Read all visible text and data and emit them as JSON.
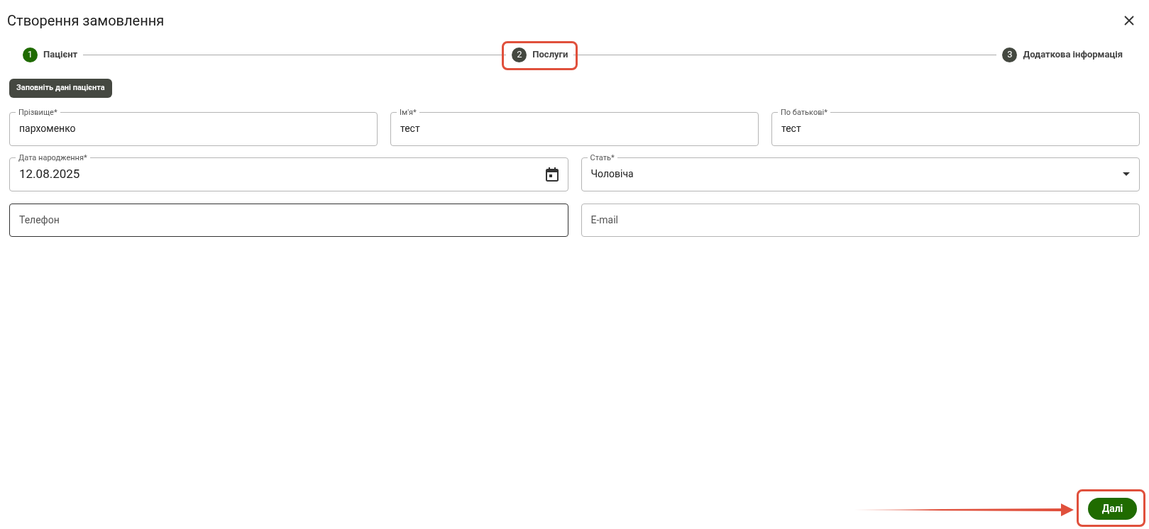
{
  "dialog": {
    "title": "Створення замовлення"
  },
  "steps": [
    {
      "number": "1",
      "label": "Пацієнт",
      "completed": true
    },
    {
      "number": "2",
      "label": "Послуги",
      "completed": false
    },
    {
      "number": "3",
      "label": "Додаткова інформація",
      "completed": false
    }
  ],
  "section_chip": "Заповніть дані пацієнта",
  "field_rows": [
    [
      {
        "kind": "text",
        "label": "Прізвище*",
        "value": "пархоменко",
        "focused": false
      },
      {
        "kind": "text",
        "label": "Ім'я*",
        "value": "тест",
        "focused": false
      },
      {
        "kind": "text",
        "label": "По батькові*",
        "value": "тест",
        "focused": false
      }
    ],
    [
      {
        "kind": "date",
        "label": "Дата народження*",
        "value": "12.08.2025",
        "focused": false
      },
      {
        "kind": "select",
        "label": "Стать*",
        "value": "Чоловіча",
        "focused": false
      }
    ],
    [
      {
        "kind": "text",
        "placeholder": "Телефон",
        "focused": true
      },
      {
        "kind": "text",
        "placeholder": "E-mail",
        "focused": false
      }
    ]
  ],
  "next_button": "Далі"
}
